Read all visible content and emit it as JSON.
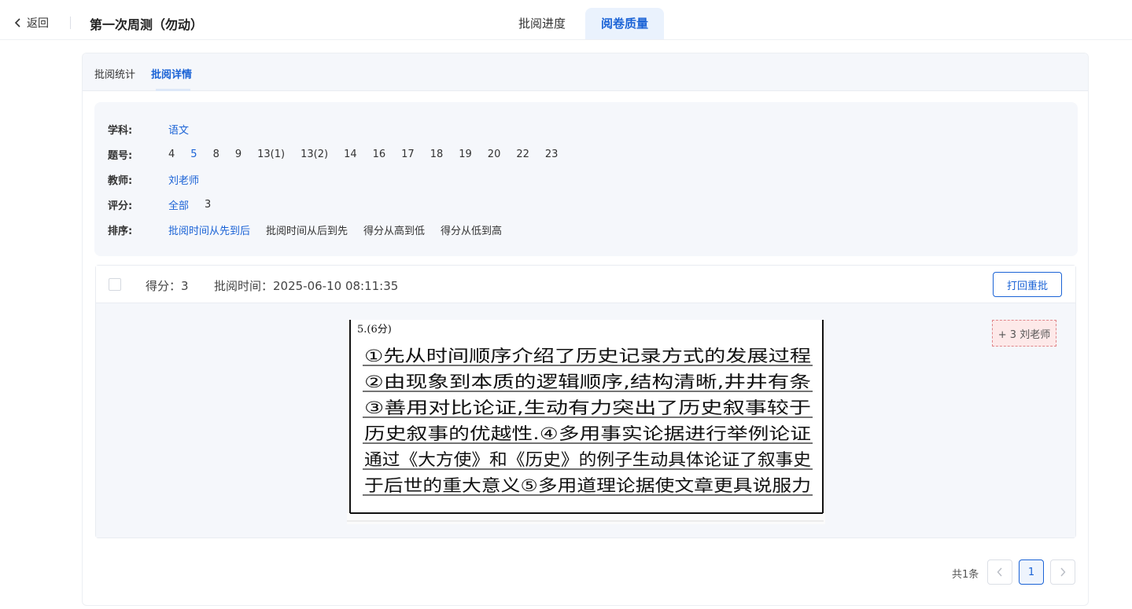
{
  "header": {
    "back_label": "返回",
    "title": "第一次周测（勿动）",
    "tabs": [
      {
        "label": "批阅进度",
        "active": false
      },
      {
        "label": "阅卷质量",
        "active": true
      }
    ]
  },
  "subtabs": [
    {
      "label": "批阅统计",
      "active": false
    },
    {
      "label": "批阅详情",
      "active": true
    }
  ],
  "filters": {
    "subject": {
      "label": "学科:",
      "options": [
        "语文"
      ],
      "active": "语文"
    },
    "question": {
      "label": "题号:",
      "options": [
        "4",
        "5",
        "8",
        "9",
        "13(1)",
        "13(2)",
        "14",
        "16",
        "17",
        "18",
        "19",
        "20",
        "22",
        "23"
      ],
      "active": "5"
    },
    "teacher": {
      "label": "教师:",
      "options": [
        "刘老师"
      ],
      "active": "刘老师"
    },
    "score": {
      "label": "评分:",
      "options": [
        "全部",
        "3"
      ],
      "active": "全部"
    },
    "sort": {
      "label": "排序:",
      "options": [
        "批阅时间从先到后",
        "批阅时间从后到先",
        "得分从高到低",
        "得分从低到高"
      ],
      "active": "批阅时间从先到后"
    }
  },
  "item": {
    "score_text": "得分：3",
    "time_text": "批阅时间：2025-06-10 08:11:35",
    "return_button": "打回重批",
    "mark_tag": "+ 3 刘老师",
    "answer": {
      "question_label": "5.(6分)",
      "lines": [
        "①先从时间顺序介绍了历史记录方式的发展过程",
        "②由现象到本质的逻辑顺序,结构清晰,井井有条",
        "③善用对比论证,生动有力突出了历史叙事较于",
        "历史叙事的优越性.④多用事实论据进行举例论证",
        "通过《大方使》和《历史》的例子生动具体论证了叙事史",
        "于后世的重大意义⑤多用道理论据使文章更具说服力"
      ]
    }
  },
  "pagination": {
    "total": "共1条",
    "current": "1"
  },
  "colors": {
    "accent": "#1b63d6",
    "panel_bg": "#f5f7fb",
    "mark_bg": "#fde9e9",
    "mark_border": "#e0868a"
  }
}
